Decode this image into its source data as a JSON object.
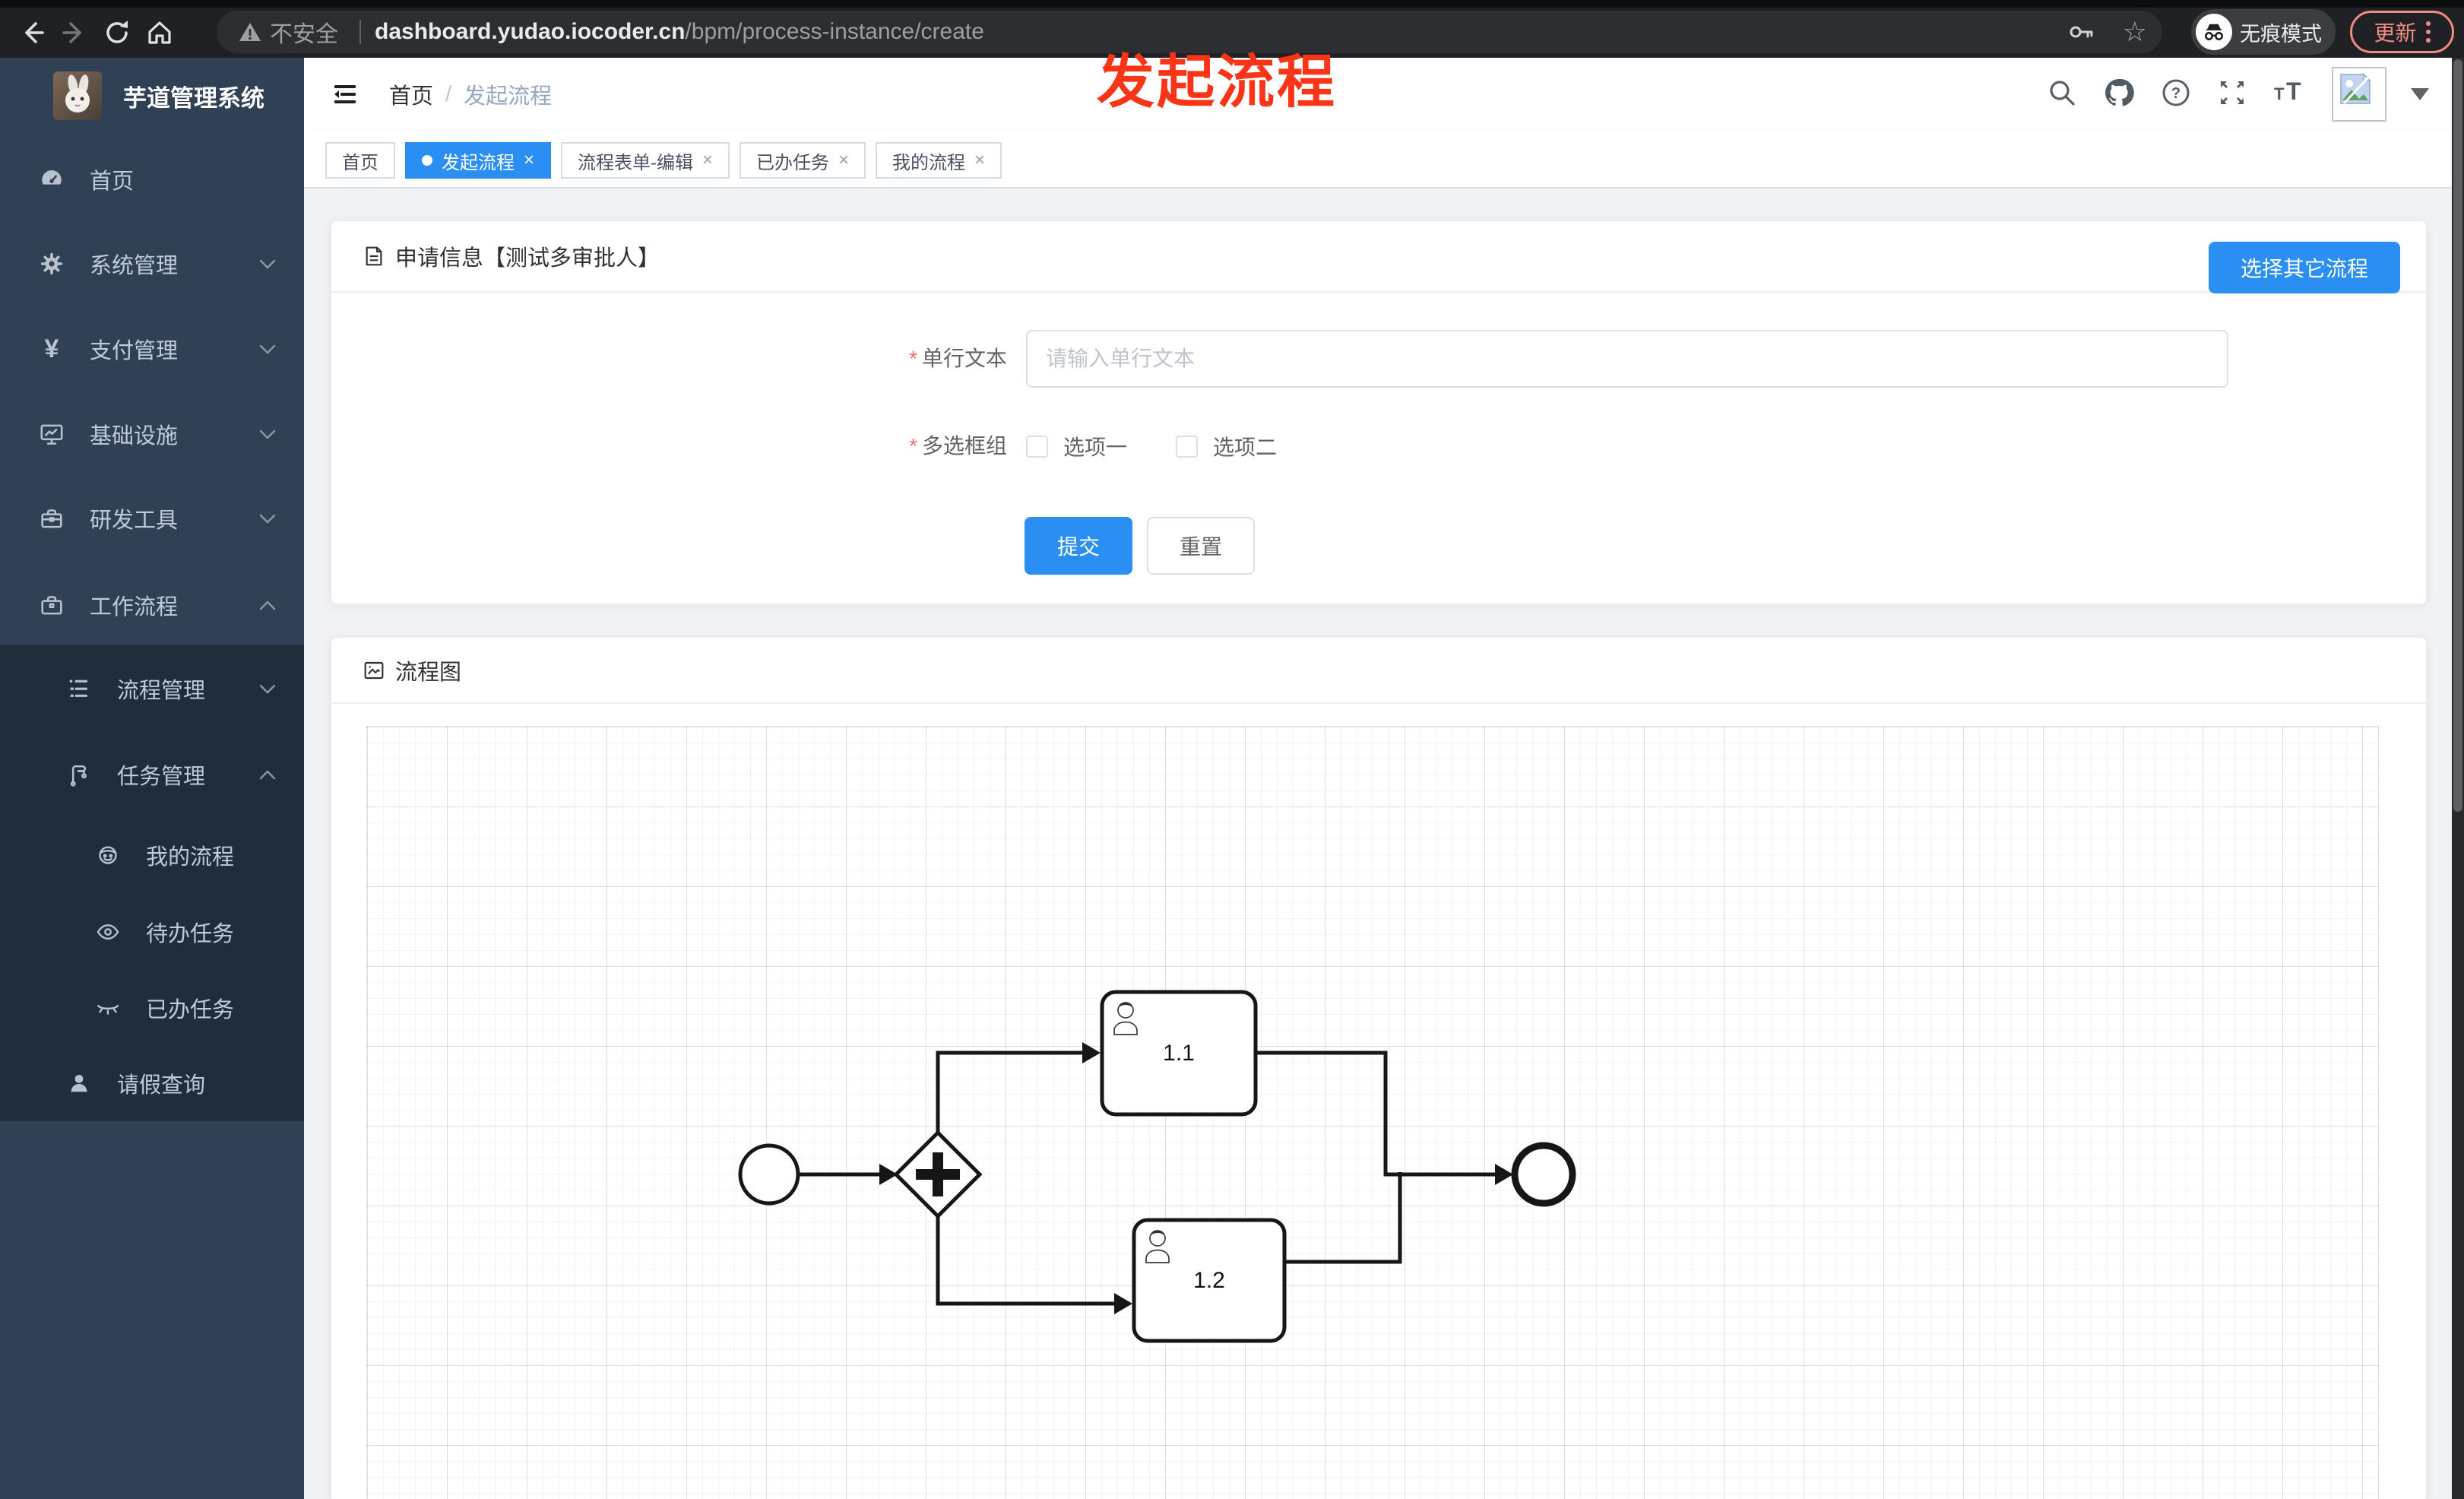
{
  "browser": {
    "security_label": "不安全",
    "url_domain": "dashboard.yudao.iocoder.cn",
    "url_path": "/bpm/process-instance/create",
    "incognito_label": "无痕模式",
    "update_label": "更新"
  },
  "annotation": {
    "text": "发起流程"
  },
  "sidebar": {
    "title": "芋道管理系统",
    "items": [
      {
        "label": "首页"
      },
      {
        "label": "系统管理"
      },
      {
        "label": "支付管理"
      },
      {
        "label": "基础设施"
      },
      {
        "label": "研发工具"
      },
      {
        "label": "工作流程"
      },
      {
        "label": "流程管理"
      },
      {
        "label": "任务管理"
      },
      {
        "label": "我的流程"
      },
      {
        "label": "待办任务"
      },
      {
        "label": "已办任务"
      },
      {
        "label": "请假查询"
      }
    ]
  },
  "breadcrumb": {
    "home": "首页",
    "separator": "/",
    "current": "发起流程"
  },
  "tabs": [
    {
      "label": "首页",
      "active": false,
      "closable": false
    },
    {
      "label": "发起流程",
      "active": true,
      "closable": true
    },
    {
      "label": "流程表单-编辑",
      "active": false,
      "closable": true
    },
    {
      "label": "已办任务",
      "active": false,
      "closable": true
    },
    {
      "label": "我的流程",
      "active": false,
      "closable": true
    }
  ],
  "close_glyph": "×",
  "form_card": {
    "title": "申请信息【测试多审批人】",
    "action_button": "选择其它流程",
    "required_mark": "*",
    "text_field": {
      "label": "单行文本",
      "placeholder": "请输入单行文本",
      "value": ""
    },
    "checkbox_group": {
      "label": "多选框组",
      "options": [
        {
          "label": "选项一",
          "checked": false
        },
        {
          "label": "选项二",
          "checked": false
        }
      ]
    },
    "submit_label": "提交",
    "reset_label": "重置"
  },
  "diagram_card": {
    "title": "流程图",
    "nodes": {
      "task1": "1.1",
      "task2": "1.2"
    }
  },
  "colors": {
    "primary": "#2b8ef3",
    "sidebar_bg": "#304156",
    "submenu_bg": "#1f2d3d",
    "annotation_red": "#fa3417",
    "chrome_update": "#f28b82"
  }
}
